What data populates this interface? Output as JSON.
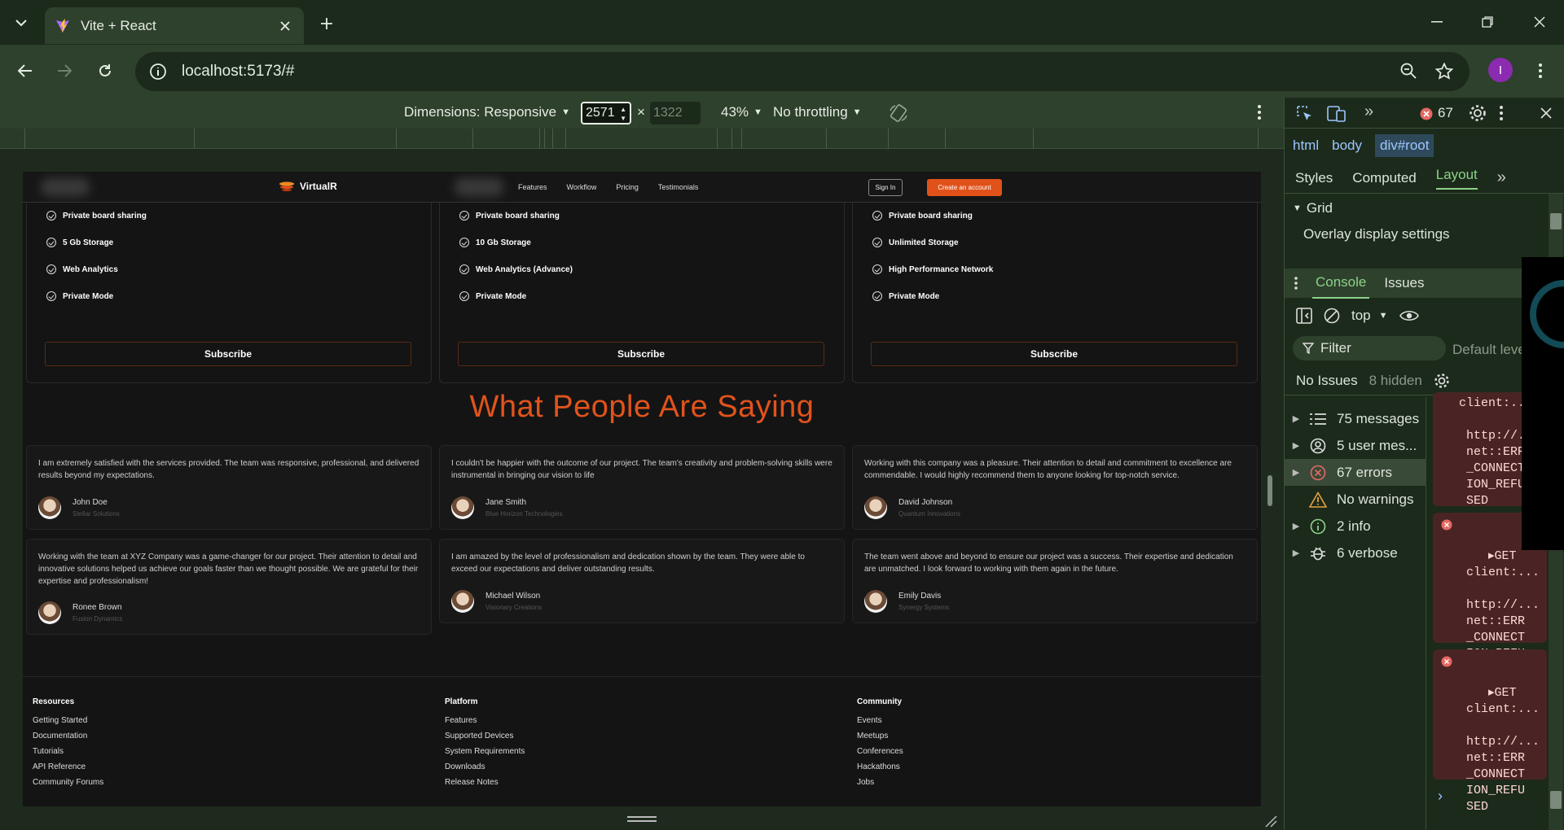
{
  "browser": {
    "tab_title": "Vite + React",
    "url": "localhost:5173/#",
    "profile_initial": "I"
  },
  "device_toolbar": {
    "dimensions_label": "Dimensions: Responsive",
    "width": "2571",
    "height": "1322",
    "times": "×",
    "zoom": "43%",
    "throttling": "No throttling"
  },
  "site": {
    "brand": "VirtualR",
    "nav_links": [
      "Features",
      "Workflow",
      "Pricing",
      "Testimonials"
    ],
    "sign_in": "Sign In",
    "create_account": "Create an account",
    "pricing_cards": [
      {
        "features": [
          "Private board sharing",
          "5 Gb Storage",
          "Web Analytics",
          "Private Mode"
        ],
        "button": "Subscribe"
      },
      {
        "features": [
          "Private board sharing",
          "10 Gb Storage",
          "Web Analytics (Advance)",
          "Private Mode"
        ],
        "button": "Subscribe"
      },
      {
        "features": [
          "Private board sharing",
          "Unlimited Storage",
          "High Performance Network",
          "Private Mode"
        ],
        "button": "Subscribe"
      }
    ],
    "testimonials_heading": "What People Are Saying",
    "testimonials": [
      {
        "text": "I am extremely satisfied with the services provided. The team was responsive, professional, and delivered results beyond my expectations.",
        "name": "John Doe",
        "company": "Stellar Solutions"
      },
      {
        "text": "I couldn't be happier with the outcome of our project. The team's creativity and problem-solving skills were instrumental in bringing our vision to life",
        "name": "Jane Smith",
        "company": "Blue Horizon Technologies"
      },
      {
        "text": "Working with this company was a pleasure. Their attention to detail and commitment to excellence are commendable. I would highly recommend them to anyone looking for top-notch service.",
        "name": "David Johnson",
        "company": "Quantum Innovations"
      },
      {
        "text": "Working with the team at XYZ Company was a game-changer for our project. Their attention to detail and innovative solutions helped us achieve our goals faster than we thought possible. We are grateful for their expertise and professionalism!",
        "name": "Ronee Brown",
        "company": "Fusion Dynamics"
      },
      {
        "text": "I am amazed by the level of professionalism and dedication shown by the team. They were able to exceed our expectations and deliver outstanding results.",
        "name": "Michael Wilson",
        "company": "Visionary Creations"
      },
      {
        "text": "The team went above and beyond to ensure our project was a success. Their expertise and dedication are unmatched. I look forward to working with them again in the future.",
        "name": "Emily Davis",
        "company": "Synergy Systems"
      }
    ],
    "footer": [
      {
        "heading": "Resources",
        "links": [
          "Getting Started",
          "Documentation",
          "Tutorials",
          "API Reference",
          "Community Forums"
        ]
      },
      {
        "heading": "Platform",
        "links": [
          "Features",
          "Supported Devices",
          "System Requirements",
          "Downloads",
          "Release Notes"
        ]
      },
      {
        "heading": "Community",
        "links": [
          "Events",
          "Meetups",
          "Conferences",
          "Hackathons",
          "Jobs"
        ]
      }
    ]
  },
  "devtools": {
    "error_count": "67",
    "breadcrumbs": [
      "html",
      "body",
      "div#root"
    ],
    "subtabs": [
      "Styles",
      "Computed",
      "Layout"
    ],
    "grid_label": "Grid",
    "overlay_label": "Overlay display settings",
    "console_tabs": [
      "Console",
      "Issues"
    ],
    "context": "top",
    "filter_placeholder": "Filter",
    "default_levels": "Default leve",
    "no_issues": "No Issues",
    "hidden": "8 hidden",
    "sidebar": [
      "75 messages",
      "5 user mes...",
      "67 errors",
      "No warnings",
      "2 info",
      "6 verbose"
    ],
    "error_messages": [
      "client:...\n   \n http://...\n net::ERR\n _CONNECT\n ION_REFU\n SED",
      "▸GET\n client:...\n   \n http://...\n net::ERR\n _CONNECT\n ION_REFU\n SED",
      "▸GET\n client:...\n   \n http://...\n net::ERR\n _CONNECT\n ION_REFU\n SED"
    ],
    "prompt": "›"
  },
  "colors": {
    "accent": "#e0531c",
    "chrome": "#2e412c",
    "devtools_accent": "#8dd28a"
  }
}
